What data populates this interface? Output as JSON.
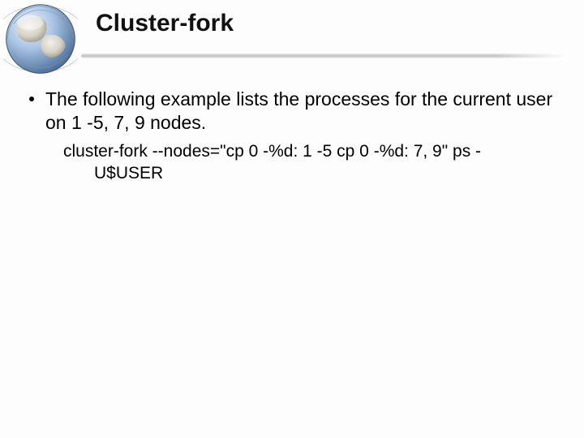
{
  "title": "Cluster-fork",
  "bullet": "The following example lists the processes for the current user on 1 -5, 7, 9 nodes.",
  "code_line1": "cluster-fork --nodes=\"cp 0 -%d: 1 -5 cp 0 -%d: 7, 9\" ps -",
  "code_line2": "U$USER"
}
